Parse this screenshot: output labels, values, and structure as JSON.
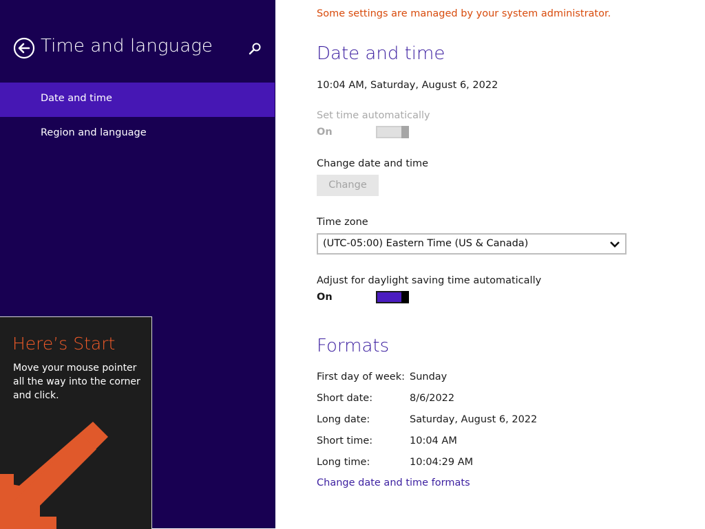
{
  "left_pane": {
    "title": "Time and language",
    "nav": [
      {
        "label": "Date and time",
        "selected": true
      },
      {
        "label": "Region and language",
        "selected": false
      }
    ],
    "background": "#180052",
    "selected_color": "#4617b4"
  },
  "start_tip": {
    "title": "Here’s Start",
    "body": "Move your mouse pointer all the way into the corner and click.",
    "accent": "#f05a28"
  },
  "admin_note": "Some settings are managed by your system administrator.",
  "date_time": {
    "heading": "Date and time",
    "current": "10:04 AM, Saturday, August 6, 2022",
    "set_auto_label": "Set time automatically",
    "set_auto_state": "On",
    "change_label": "Change date and time",
    "change_button": "Change",
    "timezone_label": "Time zone",
    "timezone_value": "(UTC-05:00) Eastern Time (US & Canada)",
    "dst_label": "Adjust for daylight saving time automatically",
    "dst_state": "On"
  },
  "formats": {
    "heading": "Formats",
    "rows": [
      {
        "label": "First day of week:",
        "value": "Sunday"
      },
      {
        "label": "Short date:",
        "value": "8/6/2022"
      },
      {
        "label": "Long date:",
        "value": "Saturday, August 6, 2022"
      },
      {
        "label": "Short time:",
        "value": "10:04 AM"
      },
      {
        "label": "Long time:",
        "value": "10:04:29 AM"
      }
    ],
    "link": "Change date and time formats"
  },
  "icons": {
    "back": "back-arrow-icon",
    "search": "search-icon",
    "dropdown": "chevron-down-icon",
    "start_arrow": "arrow-down-left-icon"
  },
  "colors": {
    "accent_purple": "#3c1fa0",
    "warning_orange": "#d84b0c",
    "toggle_on": "#4a1cc0"
  }
}
